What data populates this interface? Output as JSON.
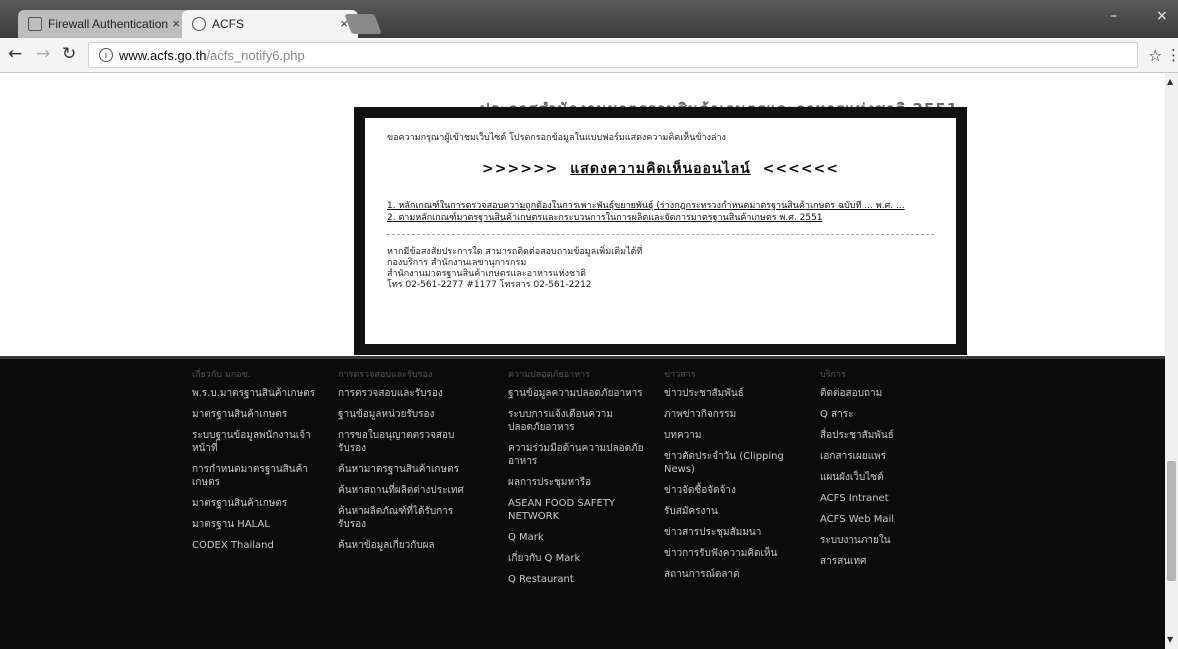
{
  "browser": {
    "tabs": [
      {
        "title": "Firewall Authentication",
        "active": false
      },
      {
        "title": "ACFS",
        "active": true
      }
    ],
    "window_controls": {
      "minimize": "–",
      "close": "×"
    },
    "url_host": "www.acfs.go.th",
    "url_path": "/acfs_notify6.php"
  },
  "page": {
    "behind_title": "ประกาศสำนักงานมาตรฐานสินค้าเกษตรและอาหารแห่งชาติ 2551"
  },
  "modal": {
    "intro": "ขอความกรุณาผู้เข้าชมเว็บไซต์ โปรดกรอกข้อมูลในแบบฟอร์มแสดงความคิดเห็นข้างล่าง",
    "banner_left": ">>>>>>",
    "banner_link": "แสดงความคิดเห็นออนไลน์",
    "banner_right": "<<<<<<",
    "links": [
      "1. หลักเกณฑ์ในการตรวจสอบความถูกต้องในการเพาะพันธุ์ขยายพันธุ์ (ร่างกฎกระทรวงกำหนดมาตรฐานสินค้าเกษตร ฉบับที่ ... พ.ศ. ...",
      "2. ตามหลักเกณฑ์มาตรฐานสินค้าเกษตรและกระบวนการในการผลิตและจัดการมาตรฐานสินค้าเกษตร พ.ศ. 2551"
    ],
    "contact": [
      "หากมีข้อสงสัยประการใด สามารถติดต่อสอบถามข้อมูลเพิ่มเติมได้ที่",
      "กองบริการ สำนักงานเลขานุการกรม",
      "สำนักงานมาตรฐานสินค้าเกษตรและอาหารแห่งชาติ",
      "โทร 02-561-2277 #1177 โทรสาร 02-561-2212"
    ]
  },
  "footer": {
    "columns": [
      {
        "items": [
          "เกี่ยวกับ มกอช.",
          "พ.ร.บ.มาตรฐานสินค้าเกษตร",
          "มาตรฐานสินค้าเกษตร",
          "ระบบฐานข้อมูลพนักงานเจ้าหน้าที่",
          "การกำหนดมาตรฐานสินค้าเกษตร",
          "มาตรฐานสินค้าเกษตร",
          "มาตรฐาน HALAL",
          "CODEX Thailand"
        ]
      },
      {
        "items": [
          "การตรวจสอบและรับรอง",
          "การตรวจสอบและรับรอง",
          "ฐานข้อมูลหน่วยรับรอง",
          "การขอใบอนุญาตตรวจสอบรับรอง",
          "ค้นหามาตรฐานสินค้าเกษตร",
          "ค้นหาสถานที่ผลิตต่างประเทศ",
          "ค้นหาผลิตภัณฑ์ที่ได้รับการรับรอง",
          "ค้นหาข้อมูลเกี่ยวกับผล"
        ]
      },
      {
        "items": [
          "ความปลอดภัยอาหาร",
          "ฐานข้อมูลความปลอดภัยอาหาร",
          "ระบบการแจ้งเตือนความปลอดภัยอาหาร",
          "ความร่วมมือด้านความปลอดภัยอาหาร",
          "ผลการประชุมหารือ",
          "ASEAN FOOD SAFETY NETWORK",
          "Q Mark",
          "เกี่ยวกับ Q Mark",
          "Q Restaurant"
        ]
      },
      {
        "items": [
          "ข่าวสาร",
          "ข่าวประชาสัมพันธ์",
          "ภาพข่าวกิจกรรม",
          "บทความ",
          "ข่าวตัดประจำวัน (Clipping News)",
          "ข่าวจัดซื้อจัดจ้าง",
          "รับสมัครงาน",
          "ข่าวสารประชุมสัมมนา",
          "ข่าวการรับฟังความคิดเห็น",
          "สถานการณ์ตลาด"
        ]
      },
      {
        "items": [
          "บริการ",
          "ติดต่อสอบถาม",
          "Q สาระ",
          "สื่อประชาสัมพันธ์",
          "เอกสารเผยแพร่",
          "แผนผังเว็บไซต์",
          "ACFS Intranet",
          "ACFS Web Mail",
          "ระบบงานภายใน",
          "สารสนเทศ"
        ]
      }
    ]
  }
}
